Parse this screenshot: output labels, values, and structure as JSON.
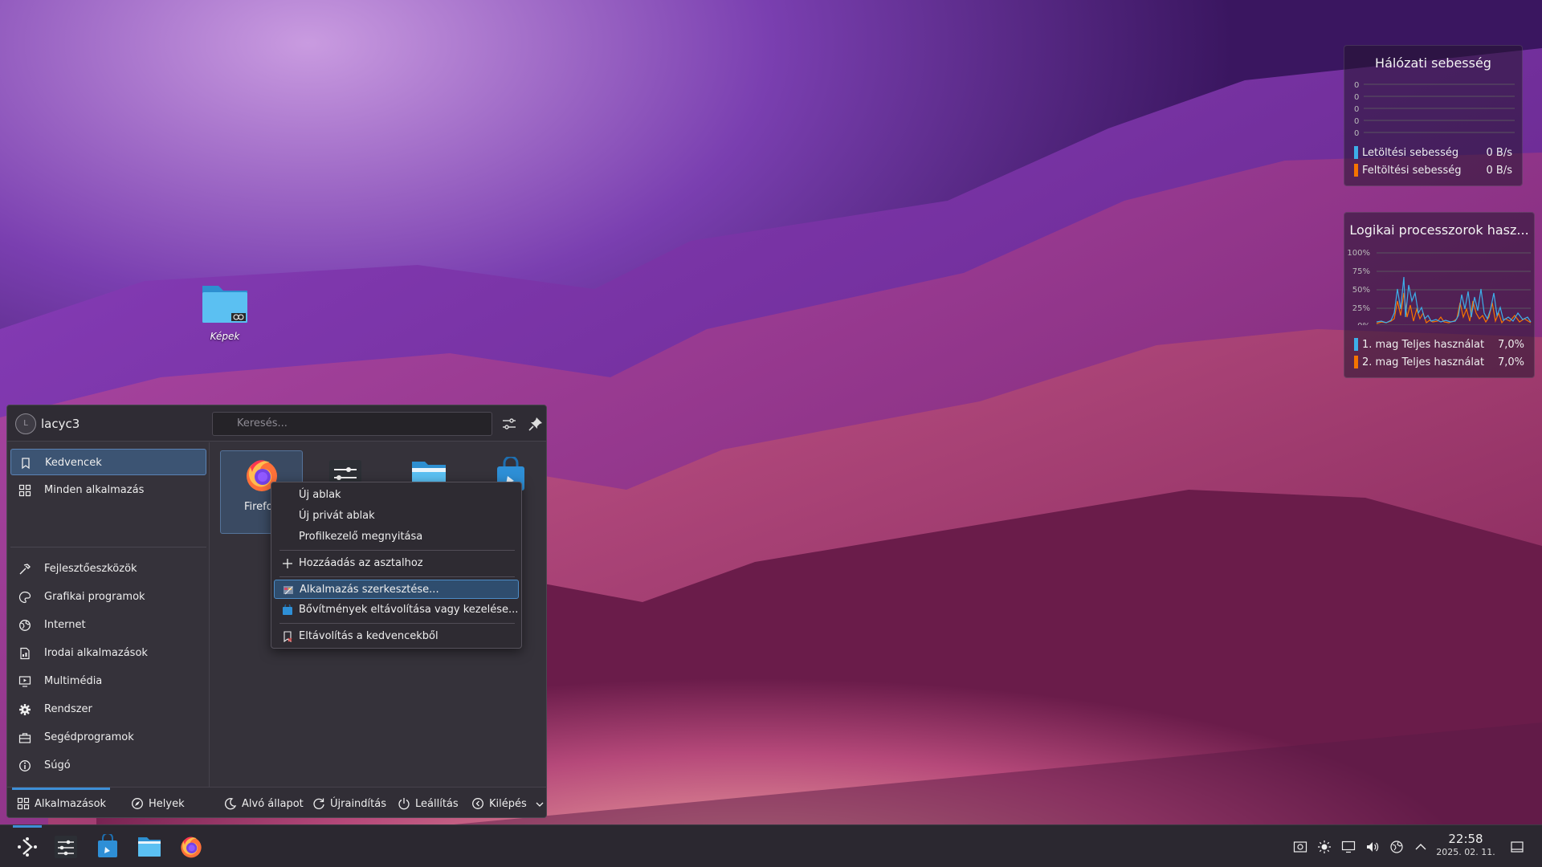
{
  "desktop": {
    "icons": [
      {
        "label": "Képek",
        "icon": "folder-pictures-icon"
      }
    ]
  },
  "widgets": {
    "network": {
      "title": "Hálózati sebesség",
      "axis_ticks": [
        "0",
        "0",
        "0",
        "0",
        "0"
      ],
      "series": [
        {
          "name": "Letöltési sebesség",
          "value": "0 B/s",
          "color": "#3daee9"
        },
        {
          "name": "Feltöltési sebesség",
          "value": "0 B/s",
          "color": "#f67400"
        }
      ]
    },
    "cpu": {
      "title": "Logikai processzorok hasz...",
      "axis_ticks": [
        "100%",
        "75%",
        "50%",
        "25%",
        "0%"
      ],
      "series": [
        {
          "name": "1. mag Teljes használat",
          "value": "7,0%",
          "color": "#3daee9"
        },
        {
          "name": "2. mag Teljes használat",
          "value": "7,0%",
          "color": "#f67400"
        }
      ]
    }
  },
  "launcher": {
    "user": {
      "name": "lacyc3",
      "avatar_initial": "L"
    },
    "search": {
      "placeholder": "Keresés..."
    },
    "sidebar": {
      "items": [
        {
          "label": "Kedvencek",
          "icon": "bookmark-icon",
          "active": true
        },
        {
          "label": "Minden alkalmazás",
          "icon": "grid-icon"
        },
        {
          "label": "Fejlesztőeszközök",
          "icon": "hammer-icon"
        },
        {
          "label": "Grafikai programok",
          "icon": "palette-icon"
        },
        {
          "label": "Internet",
          "icon": "globe-icon"
        },
        {
          "label": "Irodai alkalmazások",
          "icon": "document-icon"
        },
        {
          "label": "Multimédia",
          "icon": "monitor-play-icon"
        },
        {
          "label": "Rendszer",
          "icon": "gear-icon"
        },
        {
          "label": "Segédprogramok",
          "icon": "toolbox-icon"
        },
        {
          "label": "Súgó",
          "icon": "info-icon"
        }
      ]
    },
    "favorites": [
      {
        "label": "Firefox",
        "icon": "firefox-icon",
        "selected": true
      },
      {
        "label": "",
        "icon": "system-settings-icon"
      },
      {
        "label": "",
        "icon": "file-manager-icon"
      },
      {
        "label": "",
        "icon": "discover-store-icon"
      }
    ],
    "footer": {
      "tabs": [
        {
          "label": "Alkalmazások",
          "icon": "grid-icon",
          "active": true
        },
        {
          "label": "Helyek",
          "icon": "compass-icon"
        }
      ],
      "actions": [
        {
          "label": "Alvó állapot",
          "icon": "sleep-icon"
        },
        {
          "label": "Újraindítás",
          "icon": "restart-icon"
        },
        {
          "label": "Leállítás",
          "icon": "power-icon"
        },
        {
          "label": "Kilépés",
          "icon": "logout-icon"
        }
      ]
    }
  },
  "context_menu": {
    "items": [
      {
        "label": "Új ablak"
      },
      {
        "label": "Új privát ablak"
      },
      {
        "label": "Profilkezelő megnyitása"
      },
      {
        "label": "Hozzáadás az asztalhoz",
        "icon": "plus-icon"
      },
      {
        "label": "Alkalmazás szerkesztése...",
        "icon": "edit-app-icon",
        "highlighted": true
      },
      {
        "label": "Bővítmények eltávolítása vagy kezelése...",
        "icon": "store-icon"
      },
      {
        "label": "Eltávolítás a kedvencekből",
        "icon": "bookmark-remove-icon"
      }
    ]
  },
  "taskbar": {
    "apps": [
      {
        "icon": "app-launcher-icon",
        "active": true
      },
      {
        "icon": "system-settings-icon"
      },
      {
        "icon": "discover-store-icon"
      },
      {
        "icon": "file-manager-icon"
      },
      {
        "icon": "firefox-icon"
      }
    ],
    "tray": [
      "screenshot-icon",
      "brightness-icon",
      "display-icon",
      "volume-icon",
      "network-icon",
      "expand-tray-icon"
    ],
    "clock": {
      "time": "22:58",
      "date": "2025. 02. 11."
    },
    "show_desktop_icon": "show-desktop-icon"
  }
}
